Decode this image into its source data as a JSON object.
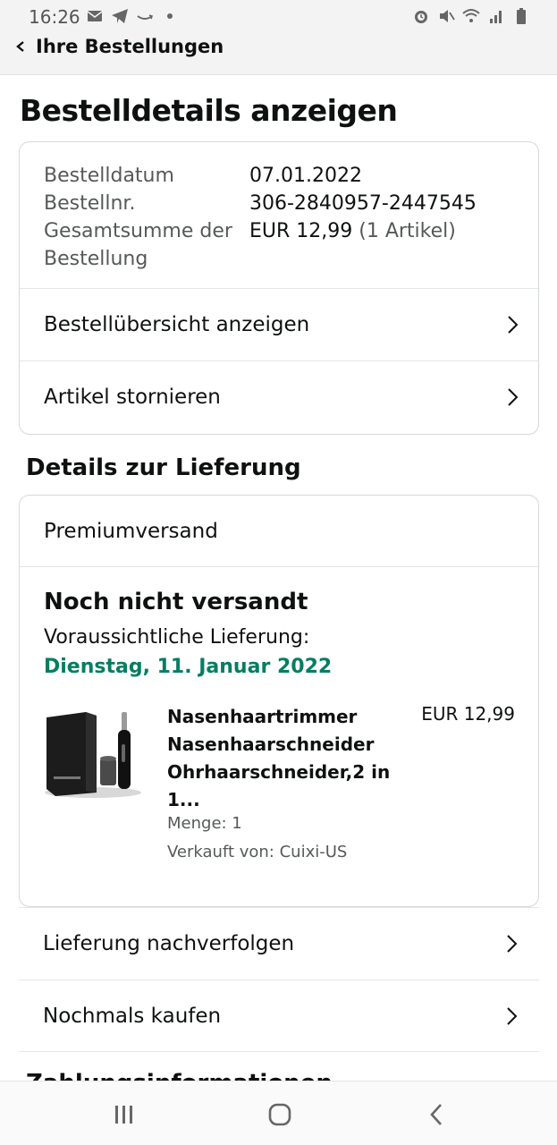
{
  "status_bar": {
    "time": "16:26",
    "left_icons": [
      "mail-icon",
      "telegram-icon",
      "amazon-smile-icon",
      "dot-icon"
    ],
    "right_icons": [
      "alarm-icon",
      "mute-icon",
      "wifi-icon",
      "signal-icon",
      "battery-icon"
    ]
  },
  "nav": {
    "back_label": "Ihre Bestellungen"
  },
  "page": {
    "title": "Bestelldetails anzeigen"
  },
  "order_info": {
    "rows": [
      {
        "label": "Bestelldatum",
        "value": "07.01.2022"
      },
      {
        "label": "Bestellnr.",
        "value": "306-2840957-2447545"
      },
      {
        "label": "Gesamtsumme der",
        "label2": "Bestellung",
        "value": "EUR 12,99",
        "value_extra": "(1 Artikel)"
      }
    ],
    "summary_link": "Bestellübersicht anzeigen",
    "cancel_link": "Artikel stornieren"
  },
  "delivery": {
    "section_title": "Details zur Lieferung",
    "shipping_method": "Premiumversand",
    "status": "Noch nicht versandt",
    "expected_label": "Voraussichtliche Lieferung:",
    "expected_date": "Dienstag, 11. Januar 2022",
    "item": {
      "title": "Nasenhaartrimmer Nasenhaarschneider Ohrhaarschneider,2 in 1...",
      "price": "EUR 12,99",
      "quantity": "Menge: 1",
      "seller": "Verkauft von: Cuixi-US"
    }
  },
  "actions": {
    "track": "Lieferung nachverfolgen",
    "buy_again": "Nochmals kaufen"
  },
  "peek": {
    "title": "Zahlungsinformationen"
  },
  "colors": {
    "accent_green": "#067d62",
    "text": "#0f1111",
    "muted": "#565959",
    "border": "#d5d9d9"
  },
  "system_nav": [
    "recent-apps-icon",
    "home-icon",
    "back-icon"
  ]
}
